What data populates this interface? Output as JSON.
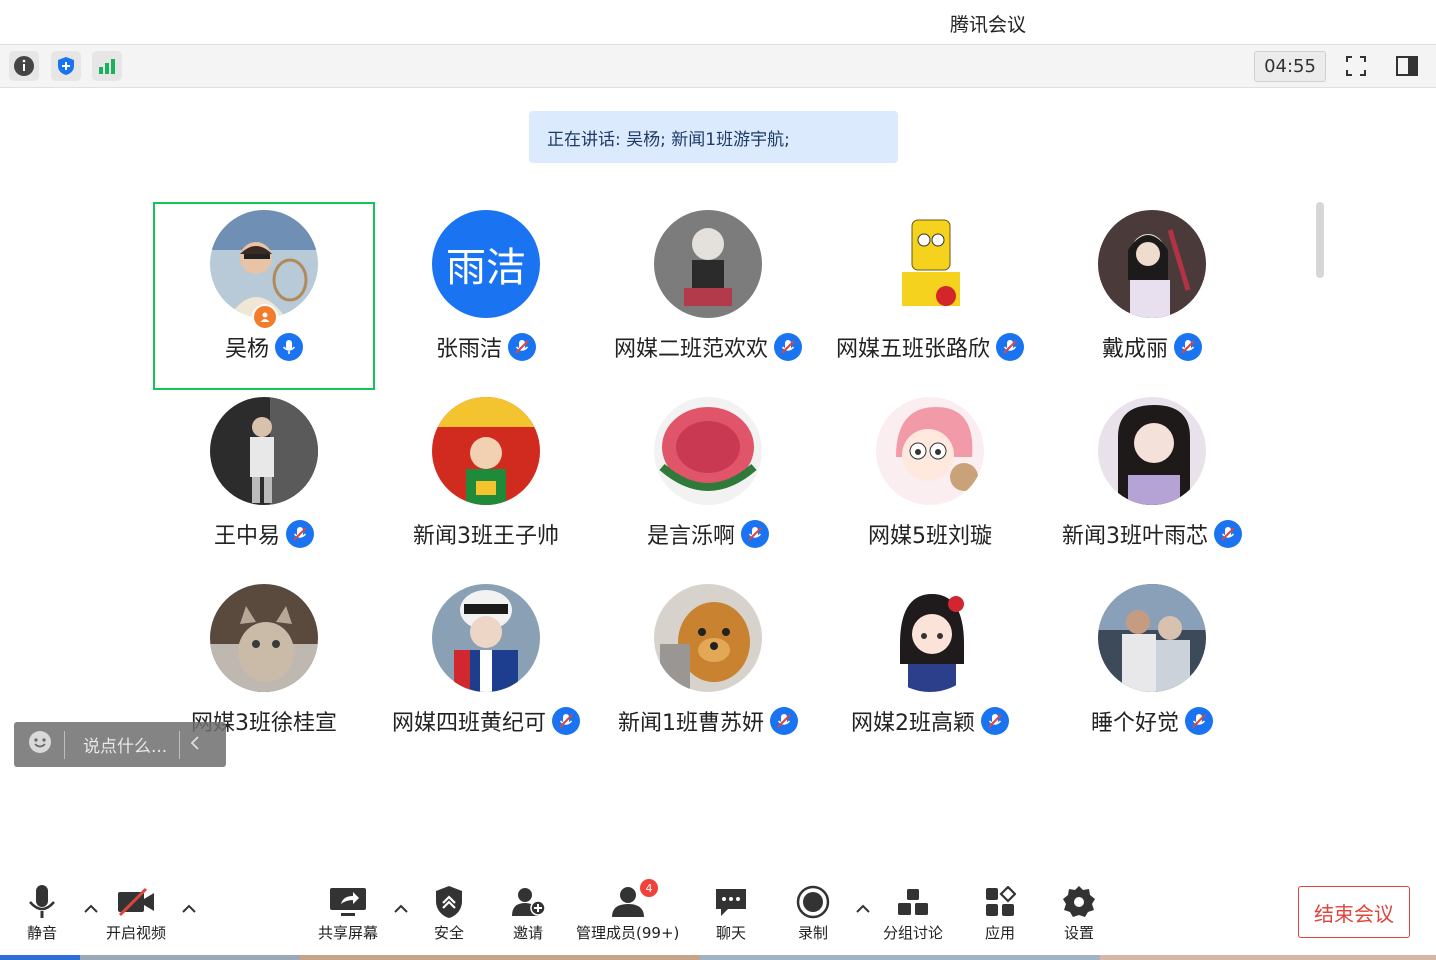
{
  "window": {
    "title": "腾讯会议"
  },
  "toolbar": {
    "timer": "04:55",
    "icons": [
      "info-icon",
      "shield-icon",
      "signal-icon",
      "fullscreen-icon",
      "sidebar-icon"
    ]
  },
  "speaking": {
    "text": "正在讲话: 吴杨; 新闻1班游宇航;"
  },
  "participants": [
    {
      "name": "吴杨",
      "avatar": "photo",
      "mic": "active",
      "host": true
    },
    {
      "name": "张雨洁",
      "avatar_text": "雨洁",
      "mic": "muted"
    },
    {
      "name": "网媒二班范欢欢",
      "avatar": "photo",
      "mic": "muted"
    },
    {
      "name": "网媒五班张路欣",
      "avatar": "photo",
      "mic": "muted"
    },
    {
      "name": "戴成丽",
      "avatar": "photo",
      "mic": "muted"
    },
    {
      "name": "王中易",
      "avatar": "photo",
      "mic": "muted"
    },
    {
      "name": "新闻3班王子帅",
      "avatar": "photo",
      "mic": "none"
    },
    {
      "name": "是言泺啊",
      "avatar": "photo",
      "mic": "muted"
    },
    {
      "name": "网媒5班刘璇",
      "avatar": "photo",
      "mic": "none"
    },
    {
      "name": "新闻3班叶雨芯",
      "avatar": "photo",
      "mic": "muted"
    },
    {
      "name": "网媒3班徐桂宣",
      "avatar": "photo",
      "mic": "none"
    },
    {
      "name": "网媒四班黄纪可",
      "avatar": "photo",
      "mic": "muted"
    },
    {
      "name": "新闻1班曹苏妍",
      "avatar": "photo",
      "mic": "muted"
    },
    {
      "name": "网媒2班高颖",
      "avatar": "photo",
      "mic": "muted"
    },
    {
      "name": "睡个好觉",
      "avatar": "photo",
      "mic": "muted"
    }
  ],
  "chat": {
    "placeholder": "说点什么..."
  },
  "bottombar": {
    "mute": "静音",
    "video": "开启视频",
    "share": "共享屏幕",
    "security": "安全",
    "invite": "邀请",
    "members": "管理成员(99+)",
    "members_badge": "4",
    "chat": "聊天",
    "record": "录制",
    "breakout": "分组讨论",
    "apps": "应用",
    "settings": "设置",
    "end": "结束会议"
  },
  "colors": {
    "accent": "#1a74f2",
    "active_frame": "#16c25a",
    "end": "#e0453d"
  }
}
